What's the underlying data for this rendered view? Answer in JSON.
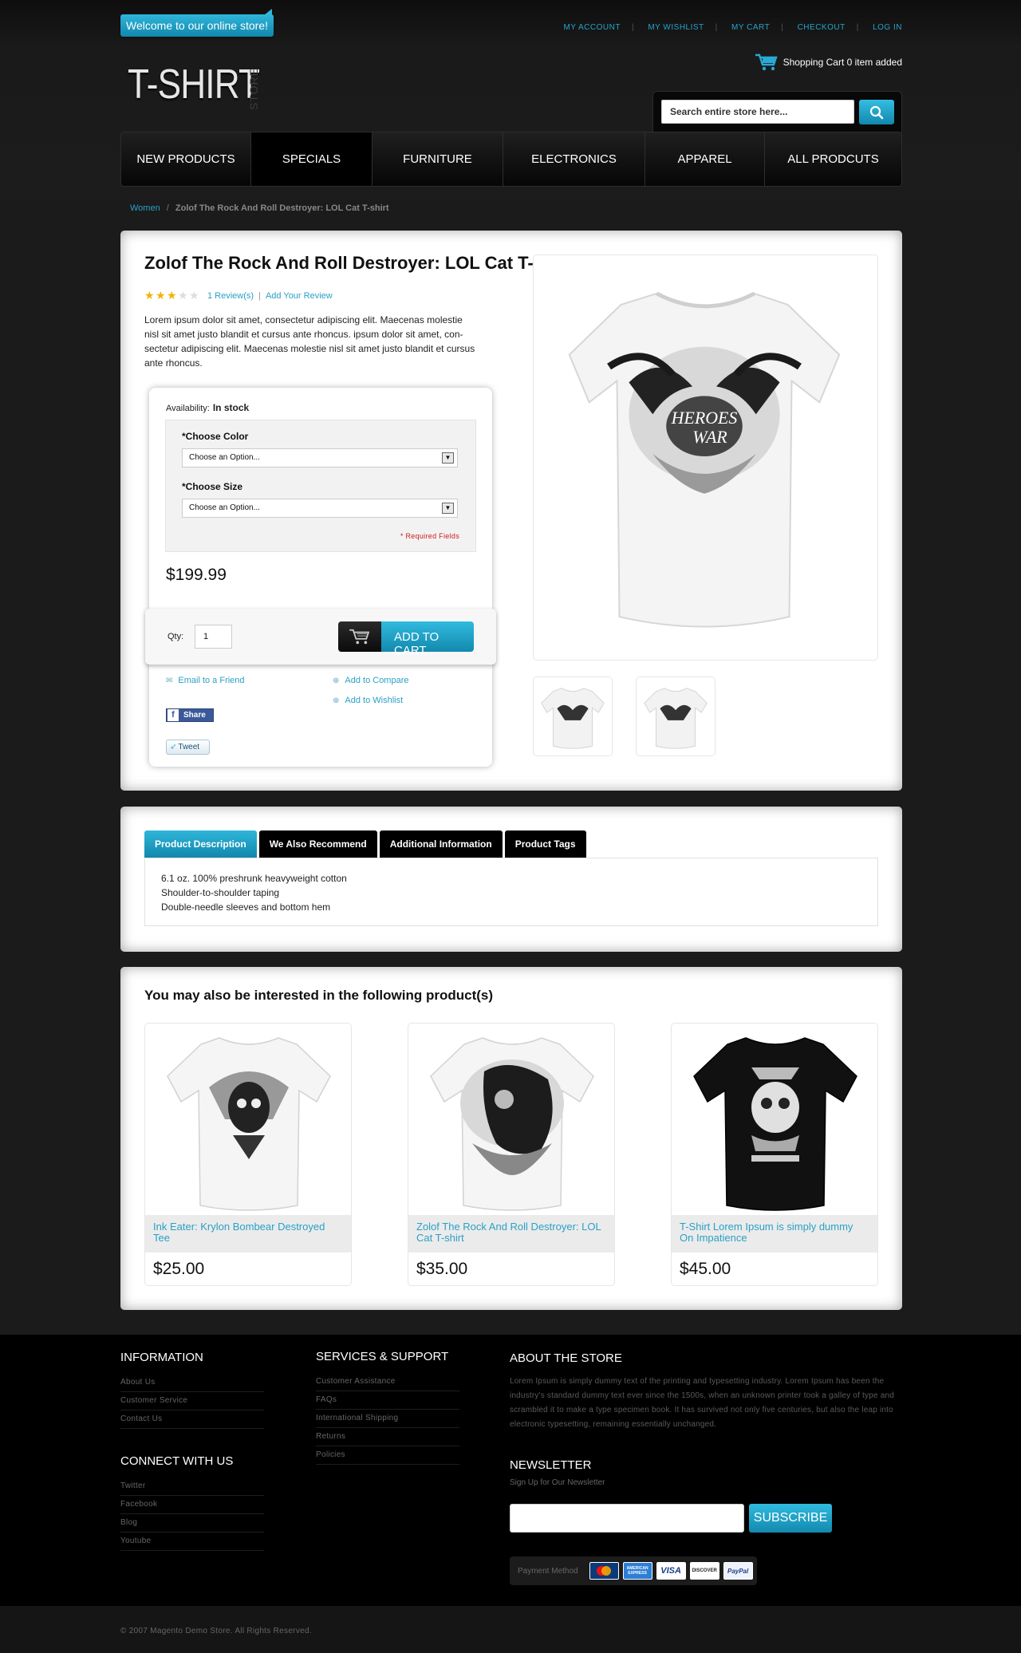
{
  "header": {
    "welcome": "Welcome to our online store!",
    "top_links": [
      "MY ACCOUNT",
      "MY WISHLIST",
      "MY CART",
      "CHECKOUT",
      "LOG IN"
    ],
    "cart_text": "Shopping Cart 0 item added",
    "logo": "T-SHIRT",
    "logo_sub": "STORE",
    "search_placeholder": "Search entire store here..."
  },
  "nav": [
    "NEW PRODUCTS",
    "SPECIALS",
    "FURNITURE",
    "ELECTRONICS",
    "APPAREL",
    "ALL PRODCUTS"
  ],
  "breadcrumb": {
    "parent": "Women",
    "separator": "/",
    "current": "Zolof The Rock And Roll Destroyer: LOL Cat T-shirt"
  },
  "product": {
    "title": "Zolof The Rock And Roll Destroyer: LOL Cat T-shirt",
    "rating": 3,
    "rating_max": 5,
    "reviews_link": "1 Review(s)",
    "add_review": "Add Your Review",
    "description": "Lorem ipsum dolor sit amet, consectetur adipiscing elit. Maecenas molestie nisl sit amet justo blandit et cursus ante rhoncus. ipsum dolor sit amet, con- sectetur adipiscing elit. Maecenas molestie nisl sit amet justo blandit et cursus ante rhoncus.",
    "availability_label": "Availability:",
    "availability": "In stock",
    "color_label": "*Choose Color",
    "color_value": "Choose an Option...",
    "size_label": "*Choose Size",
    "size_value": "Choose an Option...",
    "required_note": "* Required Fields",
    "price": "$199.99",
    "qty_label": "Qty:",
    "qty": "1",
    "add_to_cart": "ADD TO CART",
    "email_friend": "Email to a Friend",
    "add_compare": "Add to Compare",
    "add_wishlist": "Add to Wishlist",
    "share": "Share",
    "tweet": "Tweet"
  },
  "tabs": {
    "items": [
      "Product Description",
      "We Also Recommend",
      "Additional Information",
      "Product Tags"
    ],
    "active": "Product Description",
    "content": [
      "6.1 oz. 100% preshrunk heavyweight cotton",
      "Shoulder-to-shoulder taping",
      "Double-needle sleeves and bottom hem"
    ]
  },
  "related": {
    "title": "You may also be interested in the following product(s)",
    "items": [
      {
        "name": "Ink Eater: Krylon Bombear Destroyed Tee",
        "price": "$25.00",
        "shirt": "white"
      },
      {
        "name": "Zolof The Rock And Roll Destroyer: LOL Cat T-shirt",
        "price": "$35.00",
        "shirt": "white"
      },
      {
        "name": "T-Shirt Lorem Ipsum is simply dummy On Impatience",
        "price": "$45.00",
        "shirt": "black"
      }
    ]
  },
  "footer": {
    "information": {
      "title": "INFORMATION",
      "links": [
        "About Us",
        "Customer Service",
        "Contact Us"
      ]
    },
    "connect": {
      "title": "CONNECT WITH US",
      "links": [
        "Twitter",
        "Facebook",
        "Blog",
        "Youtube"
      ]
    },
    "services": {
      "title": "SERVICES & SUPPORT",
      "links": [
        "Customer Assistance",
        "FAQs",
        "International Shipping",
        "Returns",
        "Policies"
      ]
    },
    "about": {
      "title": "ABOUT THE STORE",
      "text": "Lorem Ipsum is simply dummy text of the printing and typesetting industry. Lorem Ipsum has been the industry's standard dummy text ever since the 1500s, when an unknown printer took a galley of type and scrambled it to make a type specimen book. It has survived not only five centuries, but also the leap into electronic typesetting, remaining essentially unchanged."
    },
    "newsletter": {
      "title": "NEWSLETTER",
      "subtitle": "Sign Up for Our Newsletter",
      "button": "SUBSCRIBE"
    },
    "payment_label": "Payment Method",
    "cards": [
      "MasterCard",
      "AMERICAN EXPRESS",
      "VISA",
      "DISCOVER",
      "PayPal"
    ],
    "copyright": "© 2007 Magento Demo Store. All Rights Reserved."
  },
  "colors": {
    "accent": "#1ea3cc",
    "price_text": "#111111",
    "required": "#d01b1b",
    "background": "#1b1b1b"
  }
}
